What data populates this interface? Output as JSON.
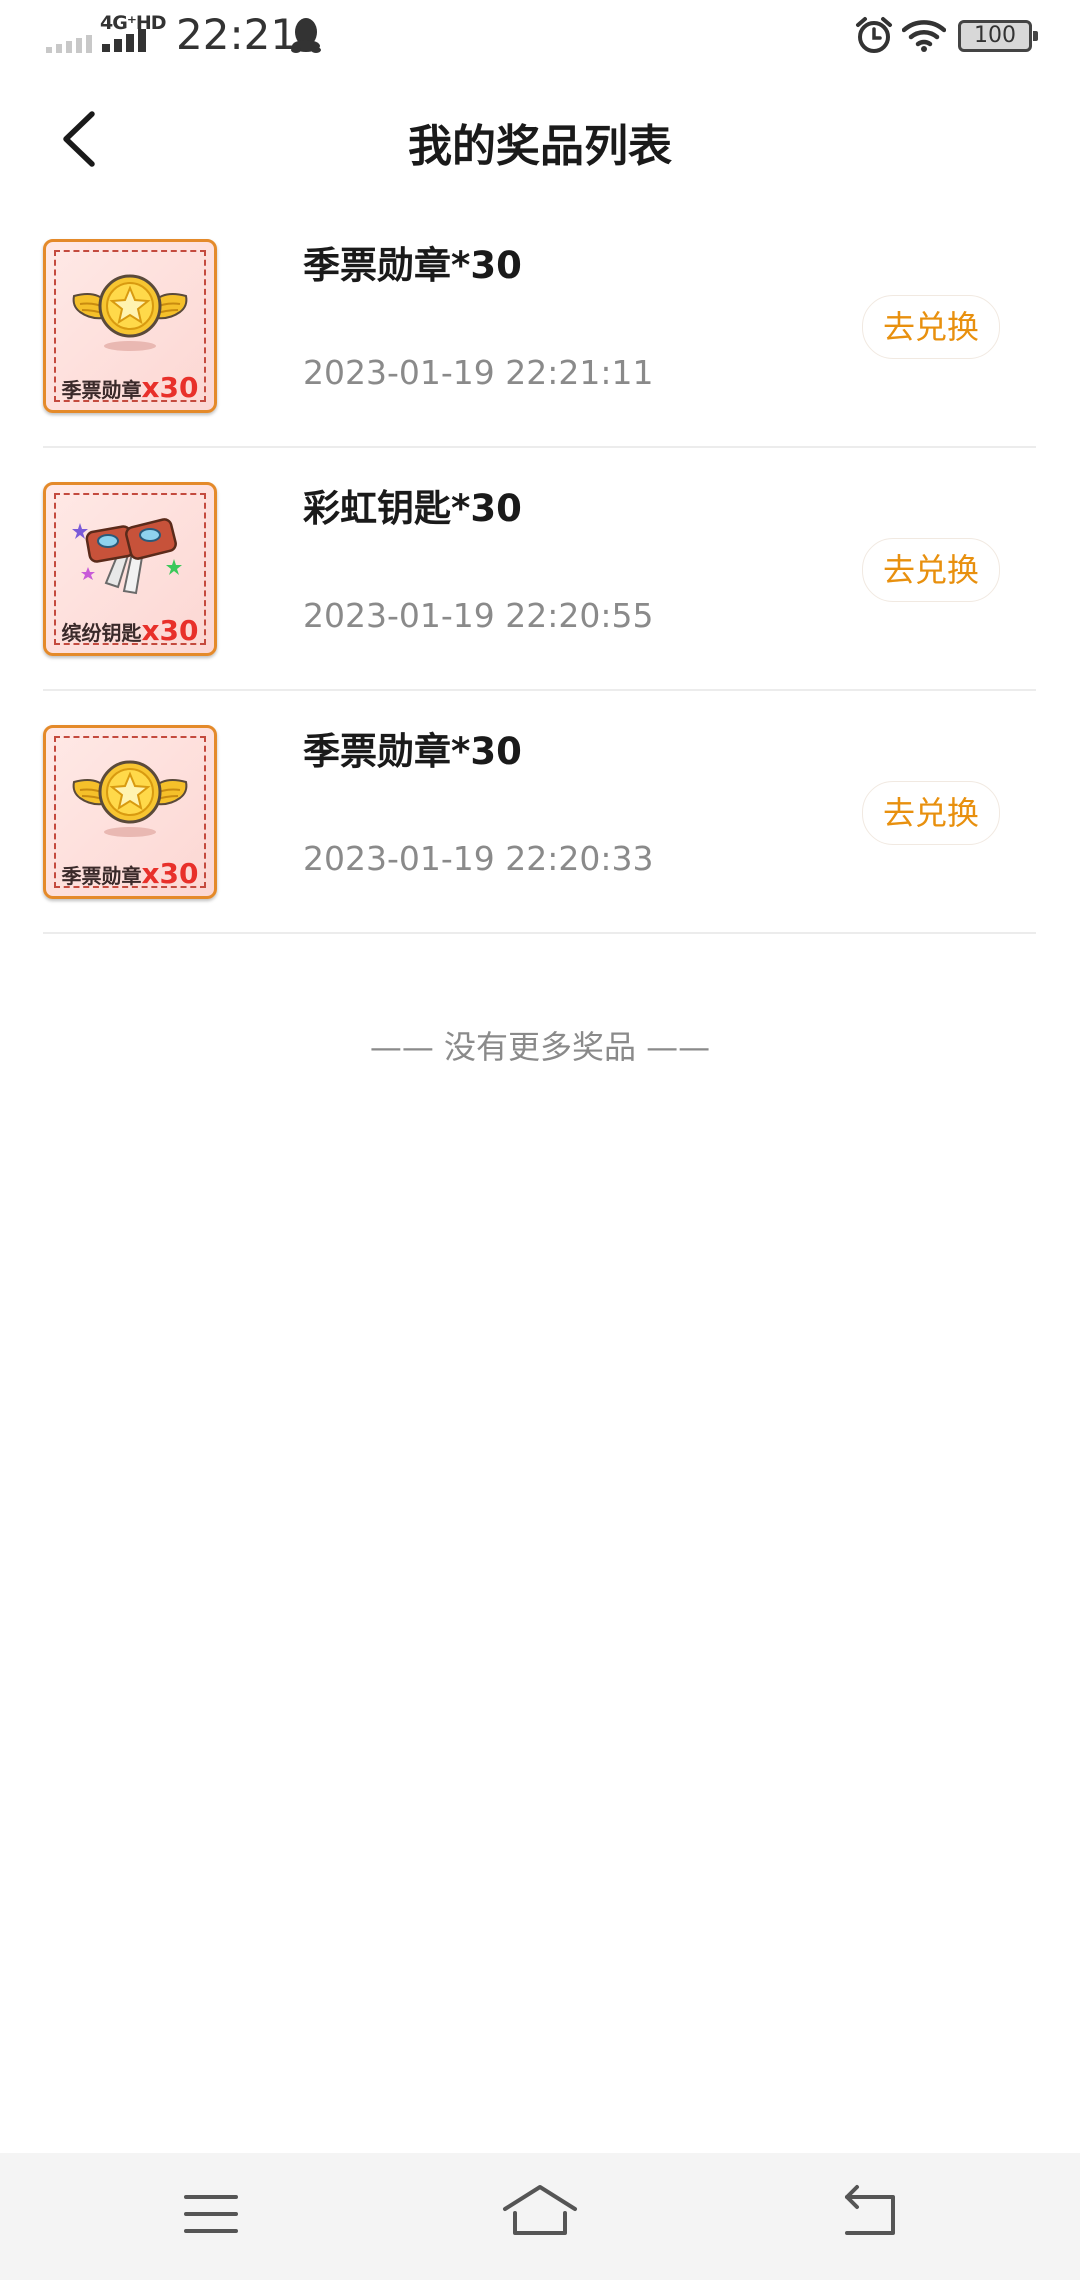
{
  "status_bar": {
    "network_type": "4G⁺HD",
    "time": "22:21",
    "battery": "100"
  },
  "header": {
    "title": "我的奖品列表",
    "back_icon": "chevron-left-icon"
  },
  "prizes": [
    {
      "name": "季票勋章*30",
      "date": "2023-01-19 22:21:11",
      "redeem_label": "去兑换",
      "image_icon": "winged-star-medal",
      "image_caption": "季票勋章",
      "image_quantity": "x30"
    },
    {
      "name": "彩虹钥匙*30",
      "date": "2023-01-19 22:20:55",
      "redeem_label": "去兑换",
      "image_icon": "colorful-keys",
      "image_caption": "缤纷钥匙",
      "image_quantity": "x30"
    },
    {
      "name": "季票勋章*30",
      "date": "2023-01-19 22:20:33",
      "redeem_label": "去兑换",
      "image_icon": "winged-star-medal",
      "image_caption": "季票勋章",
      "image_quantity": "x30"
    }
  ],
  "footer_note": "—— 没有更多奖品 ——",
  "colors": {
    "accent": "#e8900e",
    "thumb_border": "#e48a2a",
    "quantity_red": "#e8302a"
  }
}
